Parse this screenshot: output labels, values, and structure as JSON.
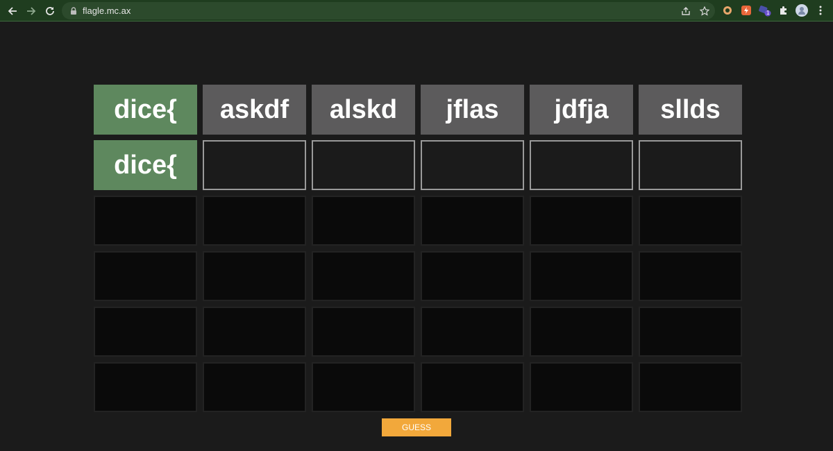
{
  "browser": {
    "url": "flagle.mc.ax",
    "extension_badge": "1"
  },
  "board": {
    "rows": [
      [
        {
          "text": "dice{",
          "state": "correct"
        },
        {
          "text": "askdf",
          "state": "used"
        },
        {
          "text": "alskd",
          "state": "used"
        },
        {
          "text": "jflas",
          "state": "used"
        },
        {
          "text": "jdfja",
          "state": "used"
        },
        {
          "text": "sllds",
          "state": "used"
        }
      ],
      [
        {
          "text": "dice{",
          "state": "correct"
        },
        {
          "text": "",
          "state": "active"
        },
        {
          "text": "",
          "state": "active"
        },
        {
          "text": "",
          "state": "active"
        },
        {
          "text": "",
          "state": "active"
        },
        {
          "text": "",
          "state": "active"
        }
      ],
      [
        {
          "text": "",
          "state": "empty"
        },
        {
          "text": "",
          "state": "empty"
        },
        {
          "text": "",
          "state": "empty"
        },
        {
          "text": "",
          "state": "empty"
        },
        {
          "text": "",
          "state": "empty"
        },
        {
          "text": "",
          "state": "empty"
        }
      ],
      [
        {
          "text": "",
          "state": "empty"
        },
        {
          "text": "",
          "state": "empty"
        },
        {
          "text": "",
          "state": "empty"
        },
        {
          "text": "",
          "state": "empty"
        },
        {
          "text": "",
          "state": "empty"
        },
        {
          "text": "",
          "state": "empty"
        }
      ],
      [
        {
          "text": "",
          "state": "empty"
        },
        {
          "text": "",
          "state": "empty"
        },
        {
          "text": "",
          "state": "empty"
        },
        {
          "text": "",
          "state": "empty"
        },
        {
          "text": "",
          "state": "empty"
        },
        {
          "text": "",
          "state": "empty"
        }
      ],
      [
        {
          "text": "",
          "state": "empty"
        },
        {
          "text": "",
          "state": "empty"
        },
        {
          "text": "",
          "state": "empty"
        },
        {
          "text": "",
          "state": "empty"
        },
        {
          "text": "",
          "state": "empty"
        },
        {
          "text": "",
          "state": "empty"
        }
      ]
    ]
  },
  "guess_button": {
    "label": "GUESS"
  },
  "colors": {
    "correct": "#5e885e",
    "used": "#5c5b5c",
    "button": "#f2a83b",
    "background": "#1b1b1b"
  }
}
